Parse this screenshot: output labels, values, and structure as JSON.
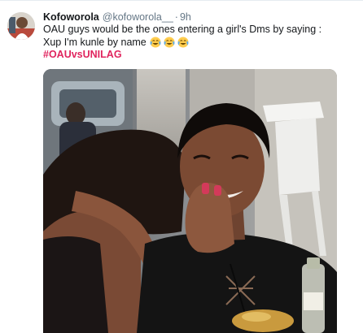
{
  "tweet": {
    "display_name": "Kofoworola",
    "handle": "@kofoworola__",
    "separator": "·",
    "time": "9h",
    "text_line1": "OAU guys would be the ones entering a girl's Dms by saying :",
    "text_line2": "Xup I'm kunle by name",
    "emojis": [
      "face-with-tears-of-joy",
      "face-with-tears-of-joy",
      "face-with-tears-of-joy"
    ],
    "hashtag": "#OAUvsUNILAG"
  },
  "colors": {
    "text": "#14171a",
    "secondary": "#657786",
    "hashtag": "#e0245e",
    "border": "#e6ecf0"
  }
}
